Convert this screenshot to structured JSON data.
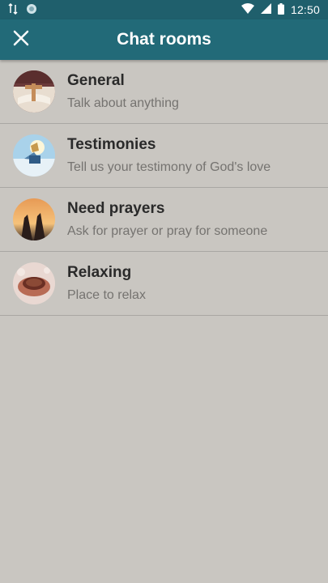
{
  "status_bar": {
    "time": "12:50",
    "icons": [
      "data-transfer-icon",
      "sync-icon",
      "wifi-icon",
      "signal-icon",
      "battery-icon"
    ]
  },
  "app_bar": {
    "title": "Chat rooms",
    "close_icon": "close-icon",
    "color": "#226a78"
  },
  "rooms": [
    {
      "name": "General",
      "description": "Talk about anything",
      "avatar": "bible-cross-image"
    },
    {
      "name": "Testimonies",
      "description": "Tell us your testimony of God's love",
      "avatar": "testimony-image"
    },
    {
      "name": "Need prayers",
      "description": "Ask for prayer or pray for someone",
      "avatar": "praying-hands-image"
    },
    {
      "name": "Relaxing",
      "description": "Place to relax",
      "avatar": "coffee-cup-image"
    }
  ],
  "colors": {
    "background": "#c9c6c1",
    "status_bar": "#1f5f6c",
    "divider": "#a9a7a3"
  }
}
